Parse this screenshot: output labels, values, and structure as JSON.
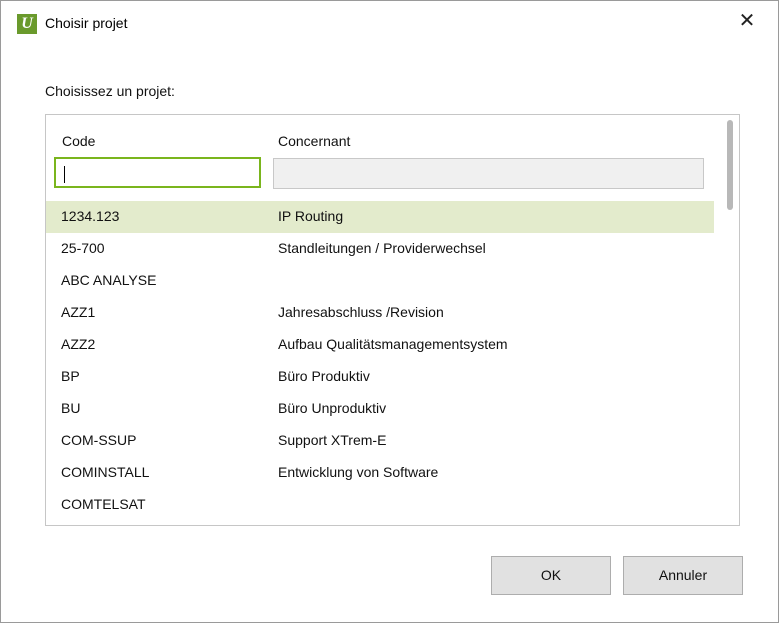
{
  "window": {
    "title": "Choisir projet",
    "app_icon_letter": "U",
    "close_glyph": "✕"
  },
  "prompt": "Choisissez un projet:",
  "columns": {
    "code": "Code",
    "concernant": "Concernant"
  },
  "filters": {
    "code_value": "",
    "concernant_value": ""
  },
  "rows": [
    {
      "code": "1234.123",
      "concernant": "IP Routing",
      "selected": true
    },
    {
      "code": "25-700",
      "concernant": "Standleitungen / Providerwechsel"
    },
    {
      "code": "ABC ANALYSE",
      "concernant": ""
    },
    {
      "code": "AZZ1",
      "concernant": "Jahresabschluss /Revision"
    },
    {
      "code": "AZZ2",
      "concernant": "Aufbau Qualitätsmanagementsystem"
    },
    {
      "code": "BP",
      "concernant": "Büro Produktiv"
    },
    {
      "code": "BU",
      "concernant": "Büro Unproduktiv"
    },
    {
      "code": "COM-SSUP",
      "concernant": "Support XTrem-E"
    },
    {
      "code": "COMINSTALL",
      "concernant": "Entwicklung von Software"
    },
    {
      "code": "COMTELSAT",
      "concernant": ""
    }
  ],
  "buttons": {
    "ok": "OK",
    "cancel": "Annuler"
  },
  "colors": {
    "selected_row": "#e3ebcc",
    "focus_border": "#7ab51d",
    "app_icon": "#6a9a2c"
  }
}
